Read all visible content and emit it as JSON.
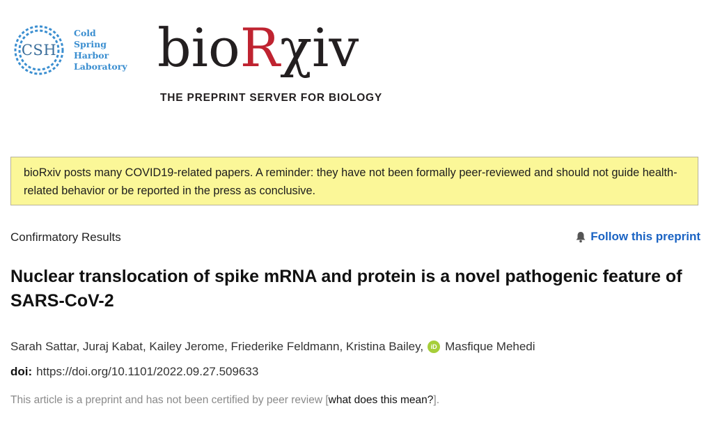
{
  "cshl": {
    "abbr": "CSH",
    "lines": [
      "Cold",
      "Spring",
      "Harbor",
      "Laboratory"
    ],
    "color": "#3a8ed0"
  },
  "logo": {
    "part1": "bio",
    "part2": "R",
    "part3": "χiv",
    "accent": "#bf2330"
  },
  "tagline": "THE PREPRINT SERVER FOR BIOLOGY",
  "notice": {
    "text": "bioRxiv posts many COVID19-related papers. A reminder: they have not been formally peer-reviewed and should not guide health-related behavior or be reported in the press as conclusive.",
    "bg": "#fbf798"
  },
  "article": {
    "category": "Confirmatory Results",
    "follow_label": "Follow this preprint",
    "follow_icon": "bell-icon",
    "title": "Nuclear translocation of spike mRNA and protein is a novel pathogenic feature of SARS-CoV-2",
    "authors_before_orcid": "Sarah Sattar, Juraj Kabat, Kailey Jerome, Friederike Feldmann, Kristina Bailey,",
    "orcid_icon": "orcid-icon",
    "orcid_text": "iD",
    "author_last": "Masfique Mehedi",
    "doi_label": "doi:",
    "doi_value": "https://doi.org/10.1101/2022.09.27.509633",
    "cert_text": "This article is a preprint and has not been certified by peer review [",
    "cert_link": "what does this mean?",
    "cert_end": "]."
  },
  "colors": {
    "link": "#1a63c3"
  }
}
